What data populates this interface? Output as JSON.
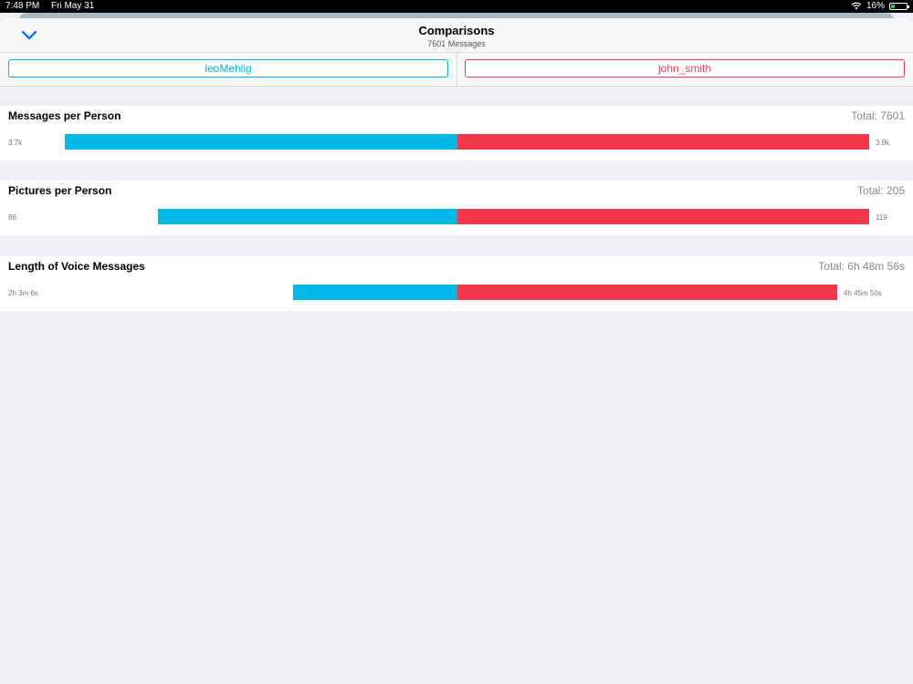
{
  "status": {
    "time": "7:48 PM",
    "date": "Fri May 31",
    "battery": "16%"
  },
  "header": {
    "title": "Comparisons",
    "subtitle": "7601 Messages"
  },
  "people": {
    "a": "leoMehlig",
    "b": "john_smith"
  },
  "colors": {
    "a": "#00b9e6",
    "b": "#f2394c"
  },
  "chart_data": {
    "type": "bar",
    "orientation": "horizontal-diverging",
    "series": [
      {
        "name": "leoMehlig",
        "color": "#00b9e6"
      },
      {
        "name": "john_smith",
        "color": "#f2394c"
      }
    ],
    "charts": [
      {
        "title": "Messages per Person",
        "total": "Total: 7601",
        "left_label": "3.7k",
        "right_label": "3.9k",
        "left_value": 3700,
        "right_value": 3900,
        "max": 3900
      },
      {
        "title": "Pictures per Person",
        "total": "Total: 205",
        "left_label": "86",
        "right_label": "119",
        "left_value": 86,
        "right_value": 119,
        "max": 119
      },
      {
        "title": "Length of Voice Messages",
        "total": "Total: 6h 48m 56s",
        "left_label": "2h 3m 6s",
        "right_label": "4h 45m 50s",
        "left_value": 7386,
        "right_value": 17150,
        "max": 18600
      }
    ]
  }
}
